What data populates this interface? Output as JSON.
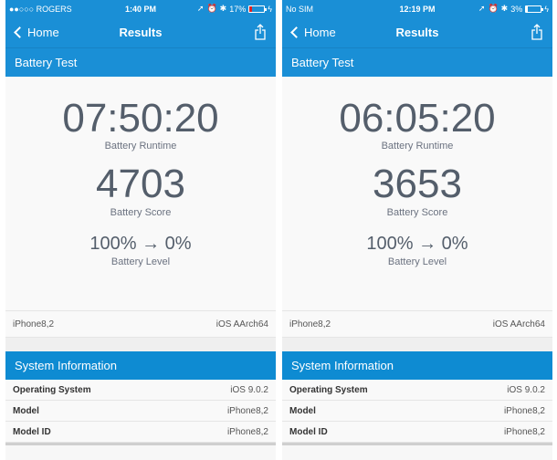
{
  "colors": {
    "accent": "#1a8fd6",
    "battery_low": "#e02020"
  },
  "phones": [
    {
      "status": {
        "carrier": "●●○○○ ROGERS",
        "time": "1:40 PM",
        "battery_pct": "17%",
        "battery_level": 0.17,
        "battery_color": "#e02020"
      },
      "nav": {
        "back_label": "Home",
        "title": "Results"
      },
      "section": "Battery Test",
      "runtime": {
        "value": "07:50:20",
        "label": "Battery Runtime"
      },
      "score": {
        "value": "4703",
        "label": "Battery Score"
      },
      "level": {
        "value": "100% → 0%",
        "label": "Battery Level"
      },
      "device": {
        "model": "iPhone8,2",
        "platform": "iOS AArch64"
      },
      "system": {
        "title": "System Information",
        "rows": [
          {
            "key": "Operating System",
            "value": "iOS 9.0.2"
          },
          {
            "key": "Model",
            "value": "iPhone8,2"
          },
          {
            "key": "Model ID",
            "value": "iPhone8,2"
          }
        ]
      }
    },
    {
      "status": {
        "carrier": "No SIM",
        "time": "12:19 PM",
        "battery_pct": "3%",
        "battery_level": 0.03,
        "battery_color": "#ffffff"
      },
      "nav": {
        "back_label": "Home",
        "title": "Results"
      },
      "section": "Battery Test",
      "runtime": {
        "value": "06:05:20",
        "label": "Battery Runtime"
      },
      "score": {
        "value": "3653",
        "label": "Battery Score"
      },
      "level": {
        "value": "100% → 0%",
        "label": "Battery Level"
      },
      "device": {
        "model": "iPhone8,2",
        "platform": "iOS AArch64"
      },
      "system": {
        "title": "System Information",
        "rows": [
          {
            "key": "Operating System",
            "value": "iOS 9.0.2"
          },
          {
            "key": "Model",
            "value": "iPhone8,2"
          },
          {
            "key": "Model ID",
            "value": "iPhone8,2"
          }
        ]
      }
    }
  ]
}
